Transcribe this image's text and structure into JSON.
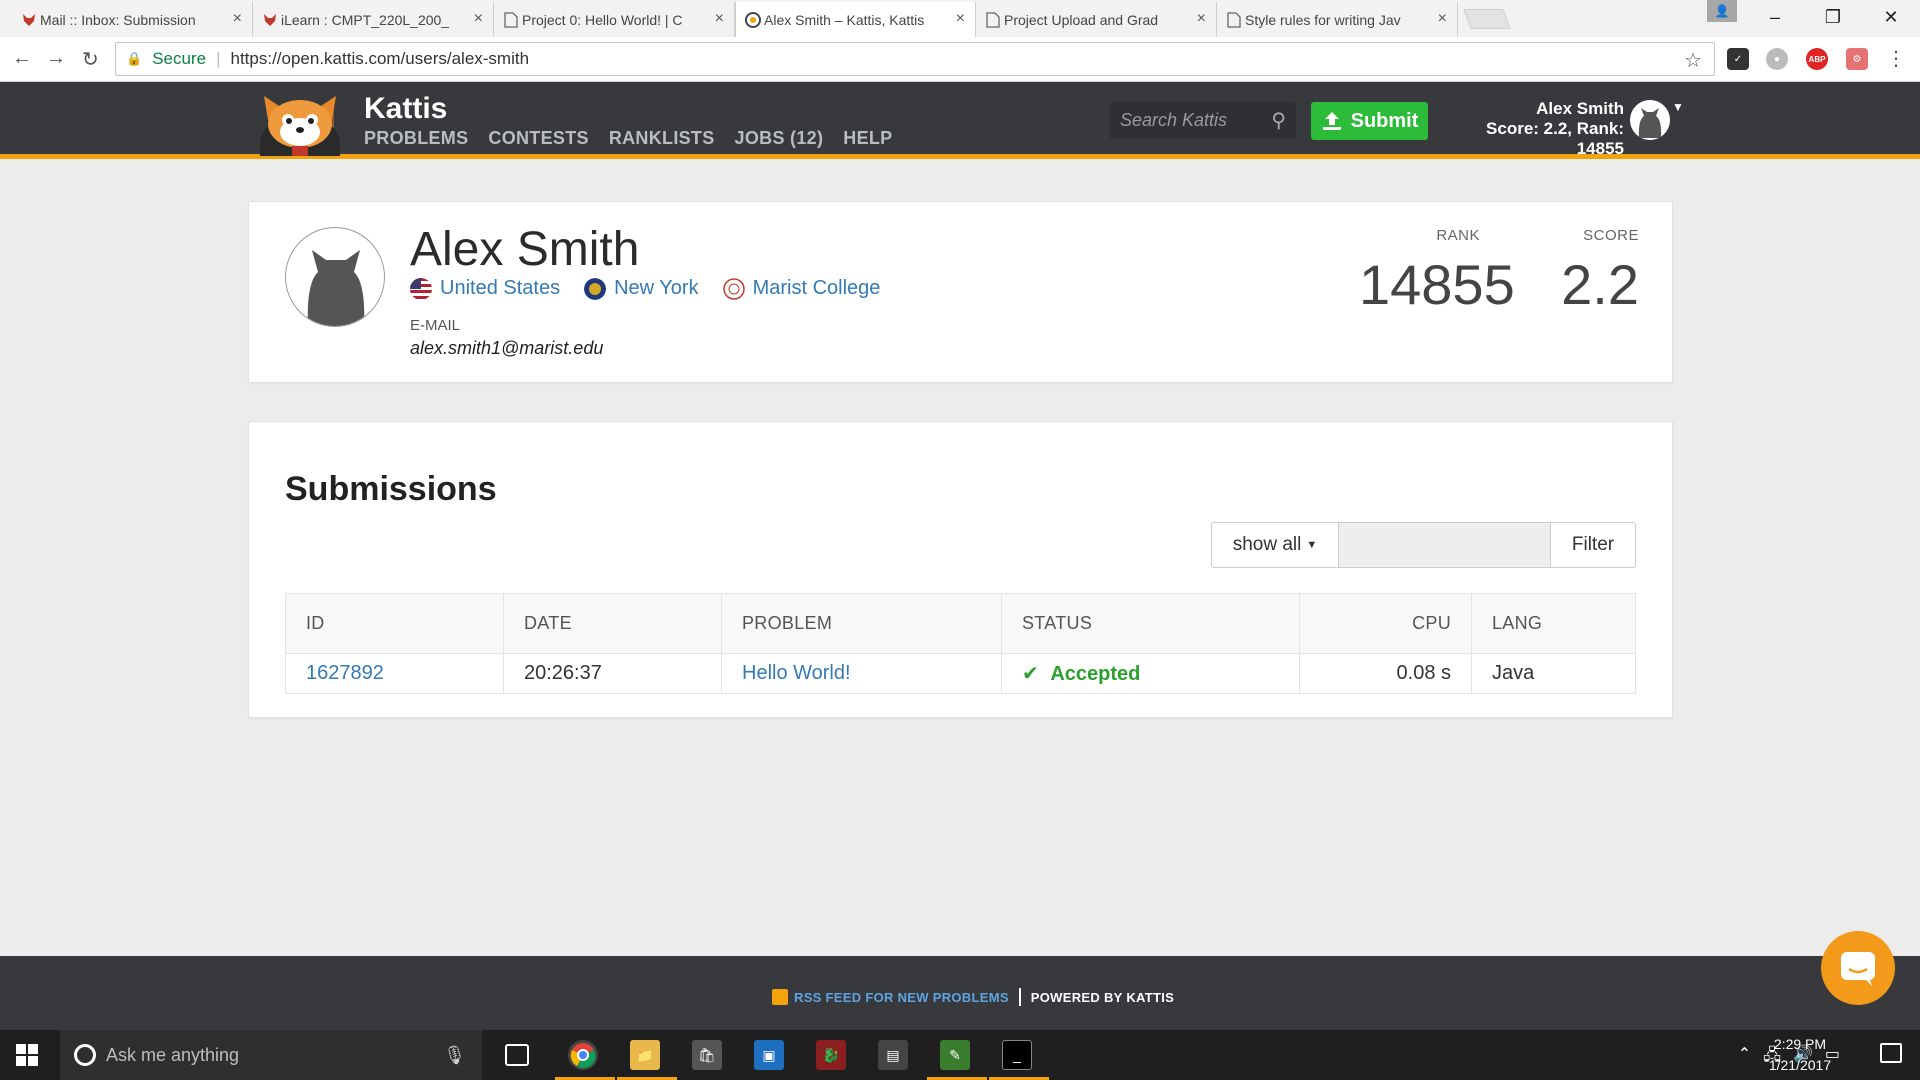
{
  "browser": {
    "tabs": [
      {
        "title": "Mail :: Inbox: Submission",
        "favicon": "fox-icon",
        "active": false
      },
      {
        "title": "iLearn : CMPT_220L_200_",
        "favicon": "fox-icon",
        "active": false
      },
      {
        "title": "Project 0: Hello World! | C",
        "favicon": "page-icon",
        "active": false
      },
      {
        "title": "Alex Smith – Kattis, Kattis",
        "favicon": "kattis-icon",
        "active": true
      },
      {
        "title": "Project Upload and Grad",
        "favicon": "page-icon",
        "active": false
      },
      {
        "title": "Style rules for writing Jav",
        "favicon": "page-icon",
        "active": false
      }
    ],
    "secure_label": "Secure",
    "url": "https://open.kattis.com/users/alex-smith",
    "extensions": [
      {
        "name": "checkmark-ext-icon",
        "color": "#333333",
        "label": "✓"
      },
      {
        "name": "ghost-ext-icon",
        "color": "#bbbbbb",
        "label": "●"
      },
      {
        "name": "adblock-ext-icon",
        "color": "#e02424",
        "label": "ABP"
      },
      {
        "name": "robot-ext-icon",
        "color": "#e57373",
        "label": "⚙"
      }
    ]
  },
  "kattis": {
    "brand": "Kattis",
    "nav": [
      "PROBLEMS",
      "CONTESTS",
      "RANKLISTS",
      "JOBS (12)",
      "HELP"
    ],
    "search_placeholder": "Search Kattis",
    "submit_label": "Submit",
    "user_name": "Alex Smith",
    "user_stats": "Score: 2.2, Rank: 14855",
    "accent": "#f3a30c"
  },
  "profile": {
    "name": "Alex Smith",
    "locations": [
      {
        "label": "United States",
        "icon": "us-flag-icon"
      },
      {
        "label": "New York",
        "icon": "ny-seal-icon"
      },
      {
        "label": "Marist College",
        "icon": "marist-seal-icon"
      }
    ],
    "email_label": "E-MAIL",
    "email": "alex.smith1@marist.edu",
    "rank_label": "RANK",
    "rank": "14855",
    "score_label": "SCORE",
    "score": "2.2"
  },
  "submissions": {
    "title": "Submissions",
    "filter_select": "show all",
    "filter_button": "Filter",
    "columns": [
      "ID",
      "DATE",
      "PROBLEM",
      "STATUS",
      "CPU",
      "LANG"
    ],
    "rows": [
      {
        "id": "1627892",
        "date": "20:26:37",
        "problem": "Hello World!",
        "status": "Accepted",
        "cpu": "0.08 s",
        "lang": "Java"
      }
    ]
  },
  "footer": {
    "rss": "RSS FEED FOR NEW PROBLEMS",
    "powered": "POWERED BY KATTIS"
  },
  "taskbar": {
    "search_placeholder": "Ask me anything",
    "time": "2:29 PM",
    "date": "1/21/2017"
  }
}
